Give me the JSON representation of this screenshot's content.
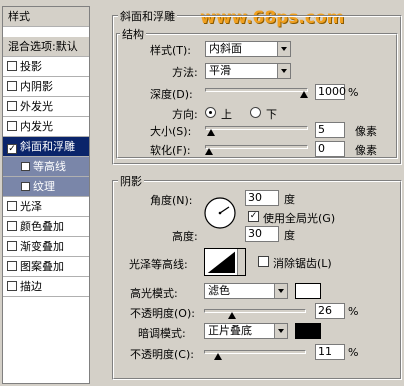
{
  "watermark": "www.68ps.com",
  "sidebar": {
    "header": "样式",
    "items": [
      {
        "label": "混合选项:默认",
        "check": false
      },
      {
        "label": "投影",
        "check": true
      },
      {
        "label": "内阴影",
        "check": true
      },
      {
        "label": "外发光",
        "check": true
      },
      {
        "label": "内发光",
        "check": true
      },
      {
        "label": "斜面和浮雕",
        "check": true
      },
      {
        "label": "等高线",
        "check": true
      },
      {
        "label": "纹理",
        "check": true
      },
      {
        "label": "光泽",
        "check": true
      },
      {
        "label": "颜色叠加",
        "check": true
      },
      {
        "label": "渐变叠加",
        "check": true
      },
      {
        "label": "图案叠加",
        "check": true
      },
      {
        "label": "描边",
        "check": true
      }
    ]
  },
  "bevel": {
    "section_title": "斜面和浮雕",
    "structure_title": "结构",
    "style_label": "样式(T):",
    "style_value": "内斜面",
    "method_label": "方法:",
    "method_value": "平滑",
    "depth_label": "深度(D):",
    "depth_value": "1000",
    "depth_unit": "%",
    "depth_level": 1.0,
    "direction_label": "方向:",
    "direction_up": "上",
    "direction_down": "下",
    "size_label": "大小(S):",
    "size_value": "5",
    "size_unit": "像素",
    "size_level": 0.02,
    "soften_label": "软化(F):",
    "soften_value": "0",
    "soften_unit": "像素",
    "soften_level": 0.0
  },
  "shading": {
    "title": "阴影",
    "angle_label": "角度(N):",
    "angle_value": "30",
    "angle_unit": "度",
    "global_light_label": "使用全局光(G)",
    "altitude_label": "高度:",
    "altitude_value": "30",
    "altitude_unit": "度",
    "gloss_label": "光泽等高线:",
    "anti_alias_label": "消除锯齿(L)",
    "highlight_mode_label": "高光模式:",
    "highlight_mode_value": "滤色",
    "highlight_color": "#ffffff",
    "highlight_opacity_label": "不透明度(O):",
    "highlight_opacity_value": "26",
    "highlight_opacity_unit": "%",
    "highlight_opacity_level": 0.26,
    "shadow_mode_label": "暗调模式:",
    "shadow_mode_value": "正片叠底",
    "shadow_color": "#000000",
    "shadow_opacity_label": "不透明度(C):",
    "shadow_opacity_value": "11",
    "shadow_opacity_unit": "%",
    "shadow_opacity_level": 0.11
  }
}
